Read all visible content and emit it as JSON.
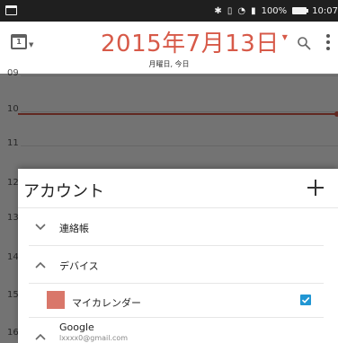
{
  "status_bar": {
    "battery": "100%",
    "time": "10:07"
  },
  "header": {
    "view_icon_day": "1",
    "title": "2015年7月13日",
    "subtitle": "月曜日, 今日"
  },
  "timeline": {
    "hours": [
      "09",
      "10",
      "11",
      "12",
      "13",
      "14",
      "15",
      "16"
    ]
  },
  "accounts_sheet": {
    "title": "アカウント",
    "add_icon": "plus-icon",
    "rows": [
      {
        "label": "連絡帳",
        "state": "collapsed"
      },
      {
        "label": "デバイス",
        "state": "expanded"
      }
    ],
    "calendar": {
      "name": "マイカレンダー",
      "color": "#d9776a",
      "checked": true
    },
    "google": {
      "label": "Google",
      "email": "lxxxx0@gmail.com",
      "state": "expanded"
    }
  },
  "colors": {
    "accent": "#d75a49",
    "checkbox": "#2196d3"
  }
}
